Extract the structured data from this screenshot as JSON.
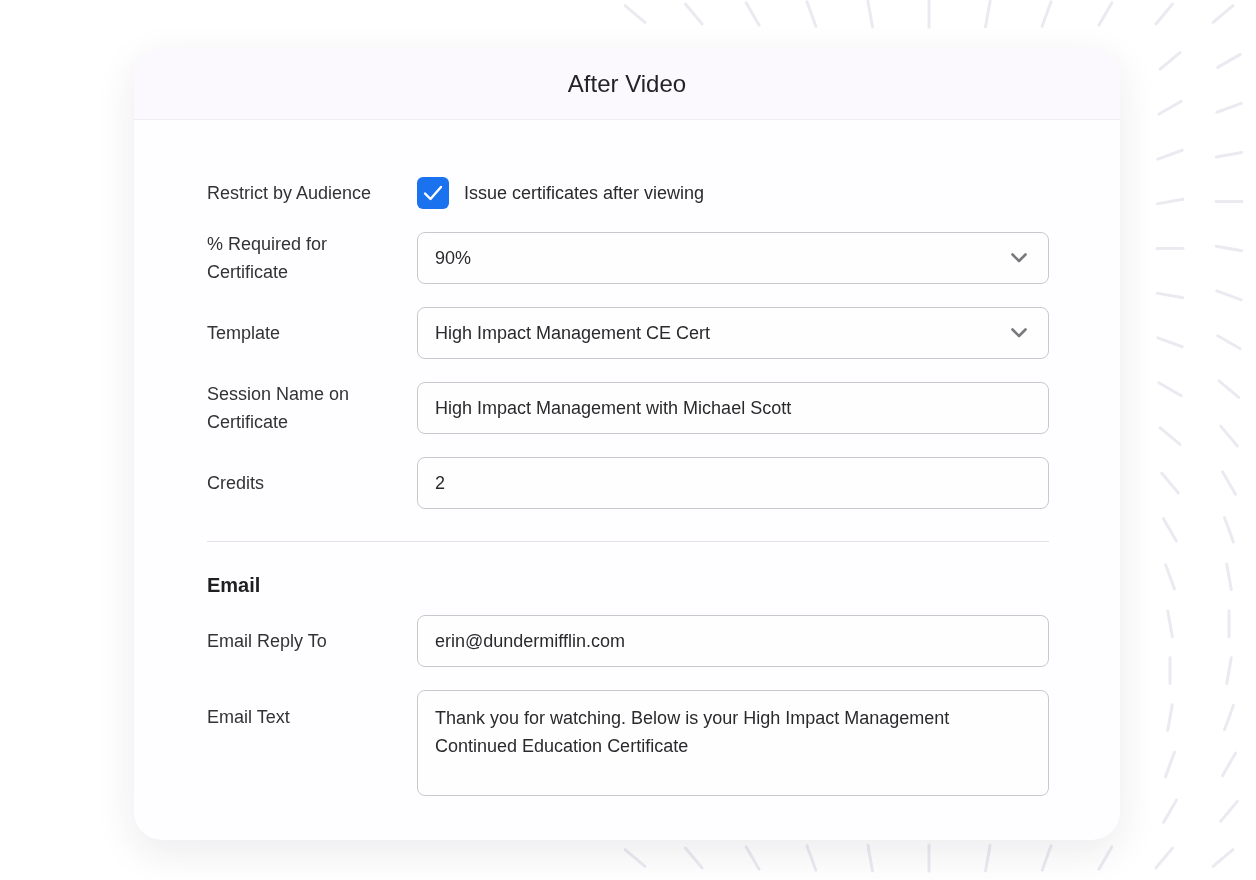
{
  "dialog": {
    "title": "After Video"
  },
  "certificate_fields": [
    {
      "kind": "checkbox",
      "label": "Restrict by Audience",
      "text": "Issue certificates after viewing",
      "checked": true
    },
    {
      "kind": "select",
      "label": "% Required for Certificate",
      "value": "90%"
    },
    {
      "kind": "select",
      "label": "Template",
      "value": "High Impact Management CE Cert"
    },
    {
      "kind": "text",
      "label": "Session Name on Certificate",
      "value": "High Impact Management with Michael Scott"
    },
    {
      "kind": "text",
      "label": "Credits",
      "value": "2"
    }
  ],
  "email_section": {
    "heading": "Email",
    "fields": [
      {
        "kind": "text",
        "label": "Email Reply To",
        "value": "erin@dundermifflin.com"
      },
      {
        "kind": "textarea",
        "label": "Email Text",
        "value": "Thank you for watching. Below is your High Impact Management Continued Education Certificate"
      }
    ]
  }
}
